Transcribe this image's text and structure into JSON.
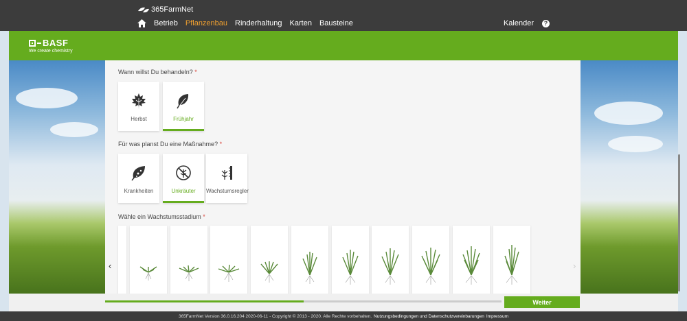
{
  "header": {
    "logo_text": "365FarmNet",
    "nav": [
      {
        "label": "Betrieb",
        "active": false
      },
      {
        "label": "Pflanzenbau",
        "active": true
      },
      {
        "label": "Rinderhaltung",
        "active": false
      },
      {
        "label": "Karten",
        "active": false
      },
      {
        "label": "Bausteine",
        "active": false
      }
    ],
    "calendar_label": "Kalender",
    "help_label": "?"
  },
  "brand": {
    "name": "BASF",
    "tagline": "We create chemistry",
    "color": "#65ac1e"
  },
  "questions": {
    "when": {
      "label": "Wann willst Du behandeln?",
      "required_mark": "*",
      "options": [
        {
          "label": "Herbst",
          "icon": "maple-leaf-icon",
          "selected": false
        },
        {
          "label": "Frühjahr",
          "icon": "leaf-icon",
          "selected": true
        }
      ]
    },
    "purpose": {
      "label": "Für was planst Du eine Maßnahme?",
      "required_mark": "*",
      "options": [
        {
          "label": "Krankheiten",
          "icon": "diseased-leaf-icon",
          "selected": false
        },
        {
          "label": "Unkräuter",
          "icon": "no-weed-icon",
          "selected": true
        },
        {
          "label": "Wachstumsregler",
          "icon": "growth-ruler-icon",
          "selected": false
        }
      ]
    },
    "stage": {
      "label": "Wähle ein Wachstumsstadium",
      "required_mark": "*",
      "prev_arrow": "‹",
      "next_arrow": "›"
    }
  },
  "progress": {
    "value_fraction": 0.5
  },
  "actions": {
    "next_label": "Weiter"
  },
  "footer": {
    "text": "365FarmNet Version 36.0.16.204 2020-06-11 - Copyright © 2013 - 2020. Alle Rechte vorbehalten.",
    "links": [
      "Nutzungsbedingungen und Datenschutzvereinbarungen",
      "Impressum"
    ]
  }
}
